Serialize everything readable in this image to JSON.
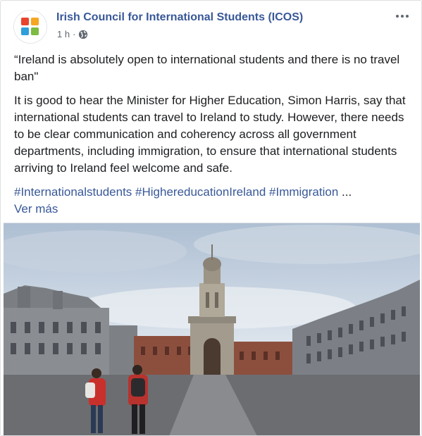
{
  "post": {
    "page_name": "Irish Council for International Students (ICOS)",
    "time": "1 h",
    "separator": "·",
    "privacy_icon": "globe-icon",
    "more_icon": "more-options-icon",
    "quote": "“Ireland is absolutely open to international students and there is no travel ban\"",
    "paragraph": "It is good to hear the Minister for Higher Education, Simon Harris, say that international students can travel to Ireland to study. However, there needs to be clear communication and coherency across all government departments, including immigration, to ensure that international students arriving to Ireland feel welcome and safe.",
    "hashtags": [
      "#Internationalstudents",
      "#HighereducationIreland",
      "#Immigration"
    ],
    "ellipsis": "...",
    "see_more": "Ver más",
    "logo_colors": [
      "#e8442d",
      "#f5a623",
      "#2e9fd9",
      "#7dbb42"
    ],
    "link_color": "#385898"
  }
}
